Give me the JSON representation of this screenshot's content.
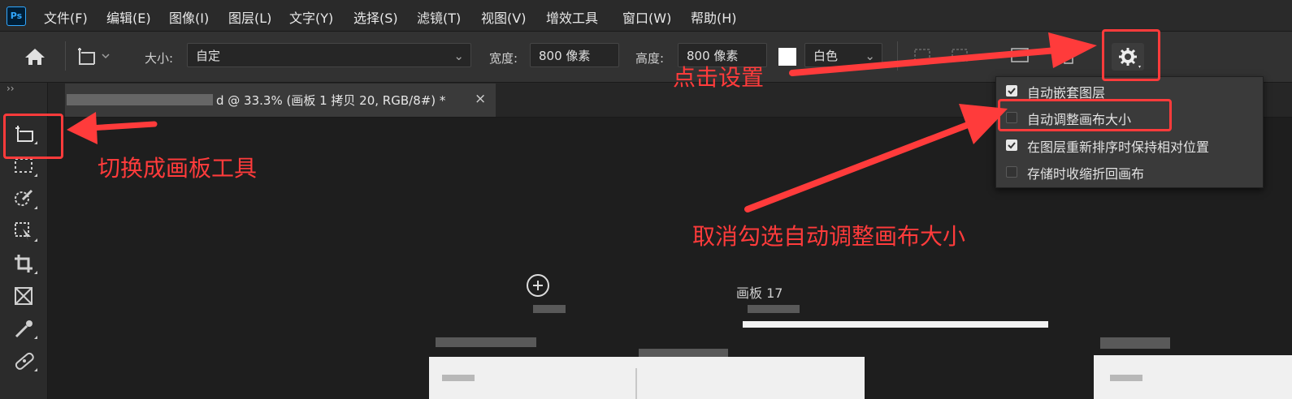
{
  "app": {
    "logo_text": "Ps"
  },
  "menu": [
    "文件(F)",
    "编辑(E)",
    "图像(I)",
    "图层(L)",
    "文字(Y)",
    "选择(S)",
    "滤镜(T)",
    "视图(V)",
    "增效工具",
    "窗口(W)",
    "帮助(H)"
  ],
  "options": {
    "size_label": "大小:",
    "size_value": "自定",
    "width_label": "宽度:",
    "width_value": "800 像素",
    "height_label": "高度:",
    "height_value": "800 像素",
    "bg_value": "白色"
  },
  "document": {
    "tab_title": "d @ 33.3% (画板 1 拷贝 20, RGB/8#) *",
    "close_glyph": "×",
    "artboard_label": "画板 17"
  },
  "settings_menu": {
    "items": [
      {
        "label": "自动嵌套图层",
        "checked": true
      },
      {
        "label": "自动调整画布大小",
        "checked": false
      },
      {
        "label": "在图层重新排序时保持相对位置",
        "checked": true
      },
      {
        "label": "存储时收缩折回画布",
        "checked": false
      }
    ]
  },
  "annotations": {
    "click_settings": "点击设置",
    "switch_tool": "切换成画板工具",
    "uncheck": "取消勾选自动调整画布大小"
  },
  "colors": {
    "annotation_red": "#ff3b3b",
    "panel_bg": "#3a3a3a"
  }
}
